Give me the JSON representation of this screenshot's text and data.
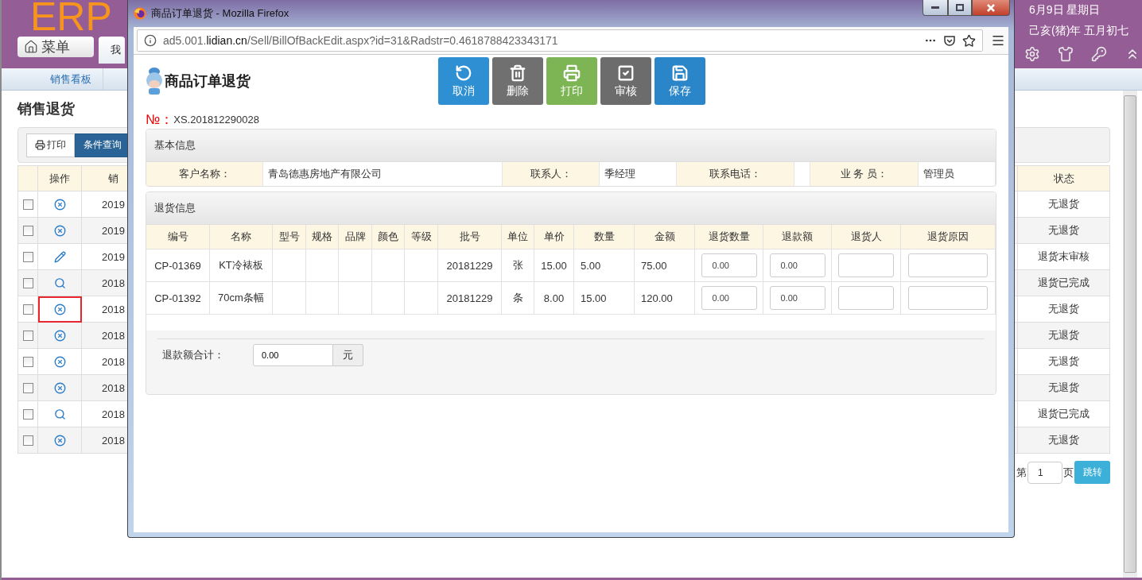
{
  "background_page": {
    "logo": "ERP",
    "menu_button": "菜单",
    "tab": "我",
    "date": "6月9日 星期日",
    "lunar_date": "己亥(猪)年 五月初七",
    "nav": [
      "销售看板"
    ],
    "title": "销售退货",
    "toolbar": [
      {
        "label": "打印",
        "kind": "print"
      },
      {
        "label": "条件查询",
        "kind": "primary"
      }
    ],
    "table": {
      "columns": [
        "操作",
        "销",
        "状态"
      ],
      "rows": [
        {
          "checked": false,
          "kind": "cancel",
          "column_3": "2019",
          "status": "无退货",
          "highlighted": false
        },
        {
          "checked": false,
          "kind": "cancel",
          "column_3": "2019",
          "status": "无退货",
          "highlighted": false
        },
        {
          "checked": false,
          "kind": "edit",
          "column_3": "2019",
          "status": "退货末审核",
          "highlighted": false
        },
        {
          "checked": false,
          "kind": "view",
          "column_3": "2018",
          "status": "退货已完成",
          "highlighted": false
        },
        {
          "checked": false,
          "kind": "cancel",
          "column_3": "2018",
          "status": "无退货",
          "highlighted": true
        },
        {
          "checked": false,
          "kind": "cancel",
          "column_3": "2018",
          "status": "无退货",
          "highlighted": false
        },
        {
          "checked": false,
          "kind": "cancel",
          "column_3": "2018",
          "status": "无退货",
          "highlighted": false
        },
        {
          "checked": false,
          "kind": "cancel",
          "column_3": "2018",
          "status": "无退货",
          "highlighted": false
        },
        {
          "checked": false,
          "kind": "view",
          "column_3": "2018",
          "status": "退货已完成",
          "highlighted": false
        },
        {
          "checked": false,
          "kind": "cancel",
          "column_3": "2018",
          "status": "无退货",
          "highlighted": false
        }
      ]
    },
    "pagination": {
      "prefix": "第",
      "page": "1",
      "suffix": "页",
      "button": "跳转"
    }
  },
  "popup": {
    "window_title": "商品订单退货 - Mozilla Firefox",
    "url": {
      "host": "ad5.001.",
      "domain": "lidian.cn",
      "path": "/Sell/BillOfBackEdit.aspx?id=31&Radstr=0.4618788423343171"
    },
    "heading": "商品订单退货",
    "buttons": [
      {
        "label": "取消",
        "kind": "cancel"
      },
      {
        "label": "删除",
        "kind": "delete"
      },
      {
        "label": "打印",
        "kind": "print"
      },
      {
        "label": "审核",
        "kind": "approve"
      },
      {
        "label": "保存",
        "kind": "save"
      }
    ],
    "number_label": "№：",
    "number": "XS.201812290028",
    "basic_info": {
      "title": "基本信息",
      "fields": [
        {
          "label": "客户名称：",
          "value": "青岛德惠房地产有限公司"
        },
        {
          "label": "联系人：",
          "value": "季经理"
        },
        {
          "label": "联系电话："
        },
        {
          "label": "业 务 员：",
          "value": "管理员"
        }
      ]
    },
    "return_info": {
      "title": "退货信息",
      "columns": [
        "编号",
        "名称",
        "型号",
        "规格",
        "品牌",
        "颜色",
        "等级",
        "批号",
        "单位",
        "单价",
        "数量",
        "金额",
        "退货数量",
        "退款额",
        "退货人",
        "退货原因"
      ],
      "rows": [
        {
          "cells": [
            {
              "kind": "text",
              "text": "CP-01369"
            },
            {
              "kind": "text",
              "text": "KT冷裱板"
            },
            {
              "kind": "blank"
            },
            {
              "kind": "blank"
            },
            {
              "kind": "blank"
            },
            {
              "kind": "blank"
            },
            {
              "kind": "blank"
            },
            {
              "kind": "text",
              "text": "20181229"
            },
            {
              "kind": "text",
              "text": "张"
            },
            {
              "kind": "text",
              "text": "15.00"
            },
            {
              "kind": "text",
              "text": "5.00"
            },
            {
              "kind": "text",
              "text": "75.00"
            },
            {
              "kind": "input",
              "value": "0.00"
            },
            {
              "kind": "input",
              "value": "0.00"
            },
            {
              "kind": "input"
            },
            {
              "kind": "input"
            }
          ]
        },
        {
          "cells": [
            {
              "kind": "text",
              "text": "CP-01392"
            },
            {
              "kind": "text",
              "text": "70cm条幅"
            },
            {
              "kind": "blank"
            },
            {
              "kind": "blank"
            },
            {
              "kind": "blank"
            },
            {
              "kind": "blank"
            },
            {
              "kind": "blank"
            },
            {
              "kind": "text",
              "text": "20181229"
            },
            {
              "kind": "text",
              "text": "条"
            },
            {
              "kind": "text",
              "text": "8.00"
            },
            {
              "kind": "text",
              "text": "15.00"
            },
            {
              "kind": "text",
              "text": "120.00"
            },
            {
              "kind": "input",
              "value": "0.00"
            },
            {
              "kind": "input",
              "value": "0.00"
            },
            {
              "kind": "input"
            },
            {
              "kind": "input"
            }
          ]
        }
      ],
      "total_label": "退款额合计：",
      "total_value": "0.00",
      "total_unit": "元"
    }
  }
}
